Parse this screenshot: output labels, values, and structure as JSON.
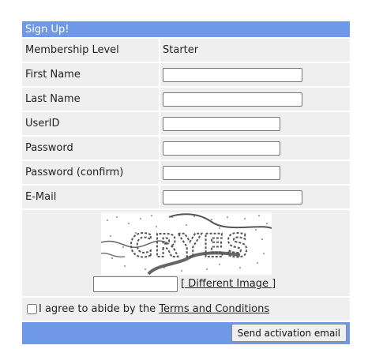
{
  "form": {
    "title": "Sign Up!",
    "fields": [
      {
        "label": "Membership Level",
        "value": "Starter"
      },
      {
        "label": "First Name",
        "value": ""
      },
      {
        "label": "Last Name",
        "value": ""
      },
      {
        "label": "UserID",
        "value": ""
      },
      {
        "label": "Password",
        "value": ""
      },
      {
        "label": "Password (confirm)",
        "value": ""
      },
      {
        "label": "E-Mail",
        "value": ""
      }
    ],
    "captcha": {
      "image_text": "CRYES",
      "input_value": "",
      "link_open": "[",
      "link_label": " Different Image ",
      "link_close": "]"
    },
    "agree": {
      "checked": false,
      "prefix": "I agree to abide by the ",
      "link_label": "Terms and Conditions"
    },
    "submit_label": "Send activation email"
  },
  "colors": {
    "header_bar": "#6f98e9",
    "row_bg": "#efefef"
  }
}
